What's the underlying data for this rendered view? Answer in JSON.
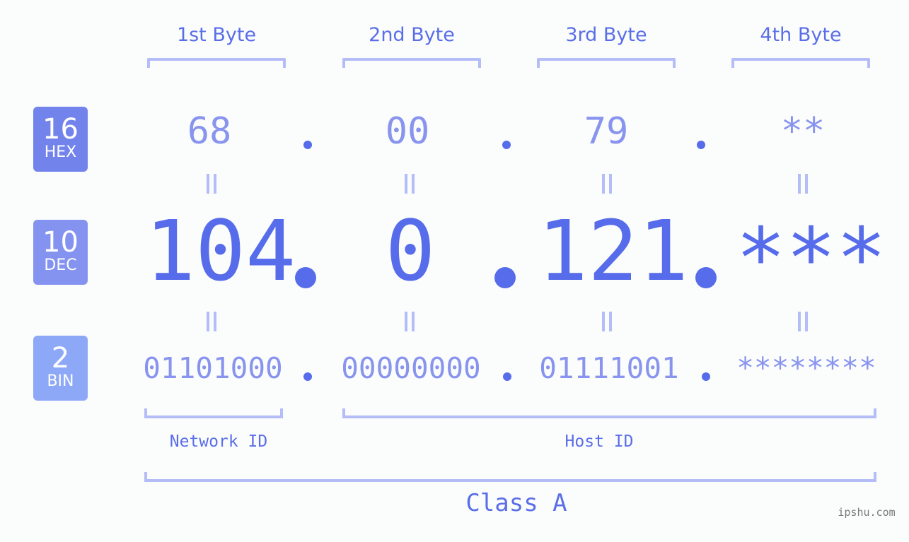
{
  "headers": [
    "1st Byte",
    "2nd Byte",
    "3rd Byte",
    "4th Byte"
  ],
  "badges": {
    "hex": {
      "num": "16",
      "label": "HEX",
      "color": "#7383ec"
    },
    "dec": {
      "num": "10",
      "label": "DEC",
      "color": "#8593f0"
    },
    "bin": {
      "num": "2",
      "label": "BIN",
      "color": "#8ea8f8"
    }
  },
  "hex": [
    "68",
    "00",
    "79",
    "**"
  ],
  "dec": [
    "104",
    "0",
    "121",
    "***"
  ],
  "bin": [
    "01101000",
    "00000000",
    "01111001",
    "********"
  ],
  "separator": ".",
  "labels": {
    "network_id": "Network ID",
    "host_id": "Host ID",
    "class": "Class A"
  },
  "watermark": "ipshu.com",
  "colors": {
    "accent": "#576ceb",
    "light_value": "#8894ee",
    "bracket": "#b4bdf8"
  }
}
